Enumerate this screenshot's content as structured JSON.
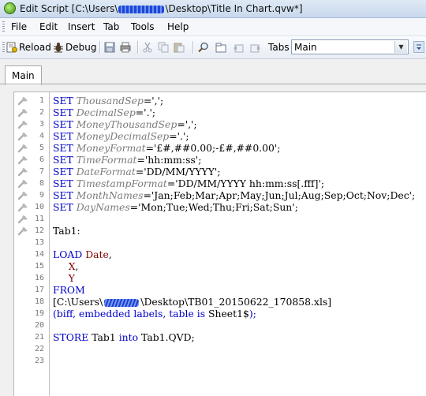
{
  "window": {
    "title_prefix": "Edit Script [C:\\Users\\",
    "title_suffix": "\\Desktop\\Title In Chart.qvw*]"
  },
  "menu": [
    "File",
    "Edit",
    "Insert",
    "Tab",
    "Tools",
    "Help"
  ],
  "toolbar": {
    "reload_label": "Reload",
    "debug_label": "Debug",
    "tabs_label": "Tabs",
    "tabs_selected": "Main"
  },
  "editor_tabs": [
    "Main"
  ],
  "code_lines": [
    {
      "n": "1",
      "parts": [
        [
          "kw",
          "SET "
        ],
        [
          "var",
          "ThousandSep"
        ],
        [
          "str",
          "=',';"
        ]
      ]
    },
    {
      "n": "2",
      "parts": [
        [
          "kw",
          "SET "
        ],
        [
          "var",
          "DecimalSep"
        ],
        [
          "str",
          "='.';"
        ]
      ]
    },
    {
      "n": "3",
      "parts": [
        [
          "kw",
          "SET "
        ],
        [
          "var",
          "MoneyThousandSep"
        ],
        [
          "str",
          "=',';"
        ]
      ]
    },
    {
      "n": "4",
      "parts": [
        [
          "kw",
          "SET "
        ],
        [
          "var",
          "MoneyDecimalSep"
        ],
        [
          "str",
          "='.';"
        ]
      ]
    },
    {
      "n": "5",
      "parts": [
        [
          "kw",
          "SET "
        ],
        [
          "var",
          "MoneyFormat"
        ],
        [
          "str",
          "='£#,##0.00;-£#,##0.00';"
        ]
      ]
    },
    {
      "n": "6",
      "parts": [
        [
          "kw",
          "SET "
        ],
        [
          "var",
          "TimeFormat"
        ],
        [
          "str",
          "='hh:mm:ss';"
        ]
      ]
    },
    {
      "n": "7",
      "parts": [
        [
          "kw",
          "SET "
        ],
        [
          "var",
          "DateFormat"
        ],
        [
          "str",
          "='DD/MM/YYYY';"
        ]
      ]
    },
    {
      "n": "8",
      "parts": [
        [
          "kw",
          "SET "
        ],
        [
          "var",
          "TimestampFormat"
        ],
        [
          "str",
          "='DD/MM/YYYY hh:mm:ss[.fff]';"
        ]
      ]
    },
    {
      "n": "9",
      "parts": [
        [
          "kw",
          "SET "
        ],
        [
          "var",
          "MonthNames"
        ],
        [
          "str",
          "='Jan;Feb;Mar;Apr;May;Jun;Jul;Aug;Sep;Oct;Nov;Dec';"
        ]
      ]
    },
    {
      "n": "10",
      "parts": [
        [
          "kw",
          "SET "
        ],
        [
          "var",
          "DayNames"
        ],
        [
          "str",
          "='Mon;Tue;Wed;Thu;Fri;Sat;Sun';"
        ]
      ]
    },
    {
      "n": "11",
      "parts": []
    },
    {
      "n": "12",
      "parts": [
        [
          "str",
          "Tab1:"
        ]
      ]
    },
    {
      "n": "13",
      "parts": []
    },
    {
      "n": "14",
      "parts": [
        [
          "kw",
          "LOAD "
        ],
        [
          "fld",
          "Date"
        ],
        [
          "str",
          ","
        ]
      ]
    },
    {
      "n": "15",
      "parts": [
        [
          "str",
          "     "
        ],
        [
          "fld",
          "X"
        ],
        [
          "str",
          ","
        ]
      ]
    },
    {
      "n": "16",
      "parts": [
        [
          "str",
          "     "
        ],
        [
          "fld",
          "Y"
        ]
      ]
    },
    {
      "n": "17",
      "parts": [
        [
          "kw",
          "FROM"
        ]
      ]
    },
    {
      "n": "18",
      "parts": [
        [
          "str",
          "[C:\\Users\\"
        ],
        [
          "redact",
          ""
        ],
        [
          "str",
          "\\Desktop\\TB01_20150622_170858.xls]"
        ]
      ]
    },
    {
      "n": "19",
      "parts": [
        [
          "blue",
          "(biff, embedded labels, table is "
        ],
        [
          "str",
          "Sheet1$"
        ],
        [
          "blue",
          ");"
        ]
      ]
    },
    {
      "n": "20",
      "parts": []
    },
    {
      "n": "21",
      "parts": [
        [
          "kw",
          "STORE "
        ],
        [
          "str",
          "Tab1 "
        ],
        [
          "kw",
          "into "
        ],
        [
          "str",
          "Tab1.QVD;"
        ]
      ]
    },
    {
      "n": "22",
      "parts": []
    },
    {
      "n": "23",
      "parts": []
    }
  ],
  "wrench_rows": 12
}
